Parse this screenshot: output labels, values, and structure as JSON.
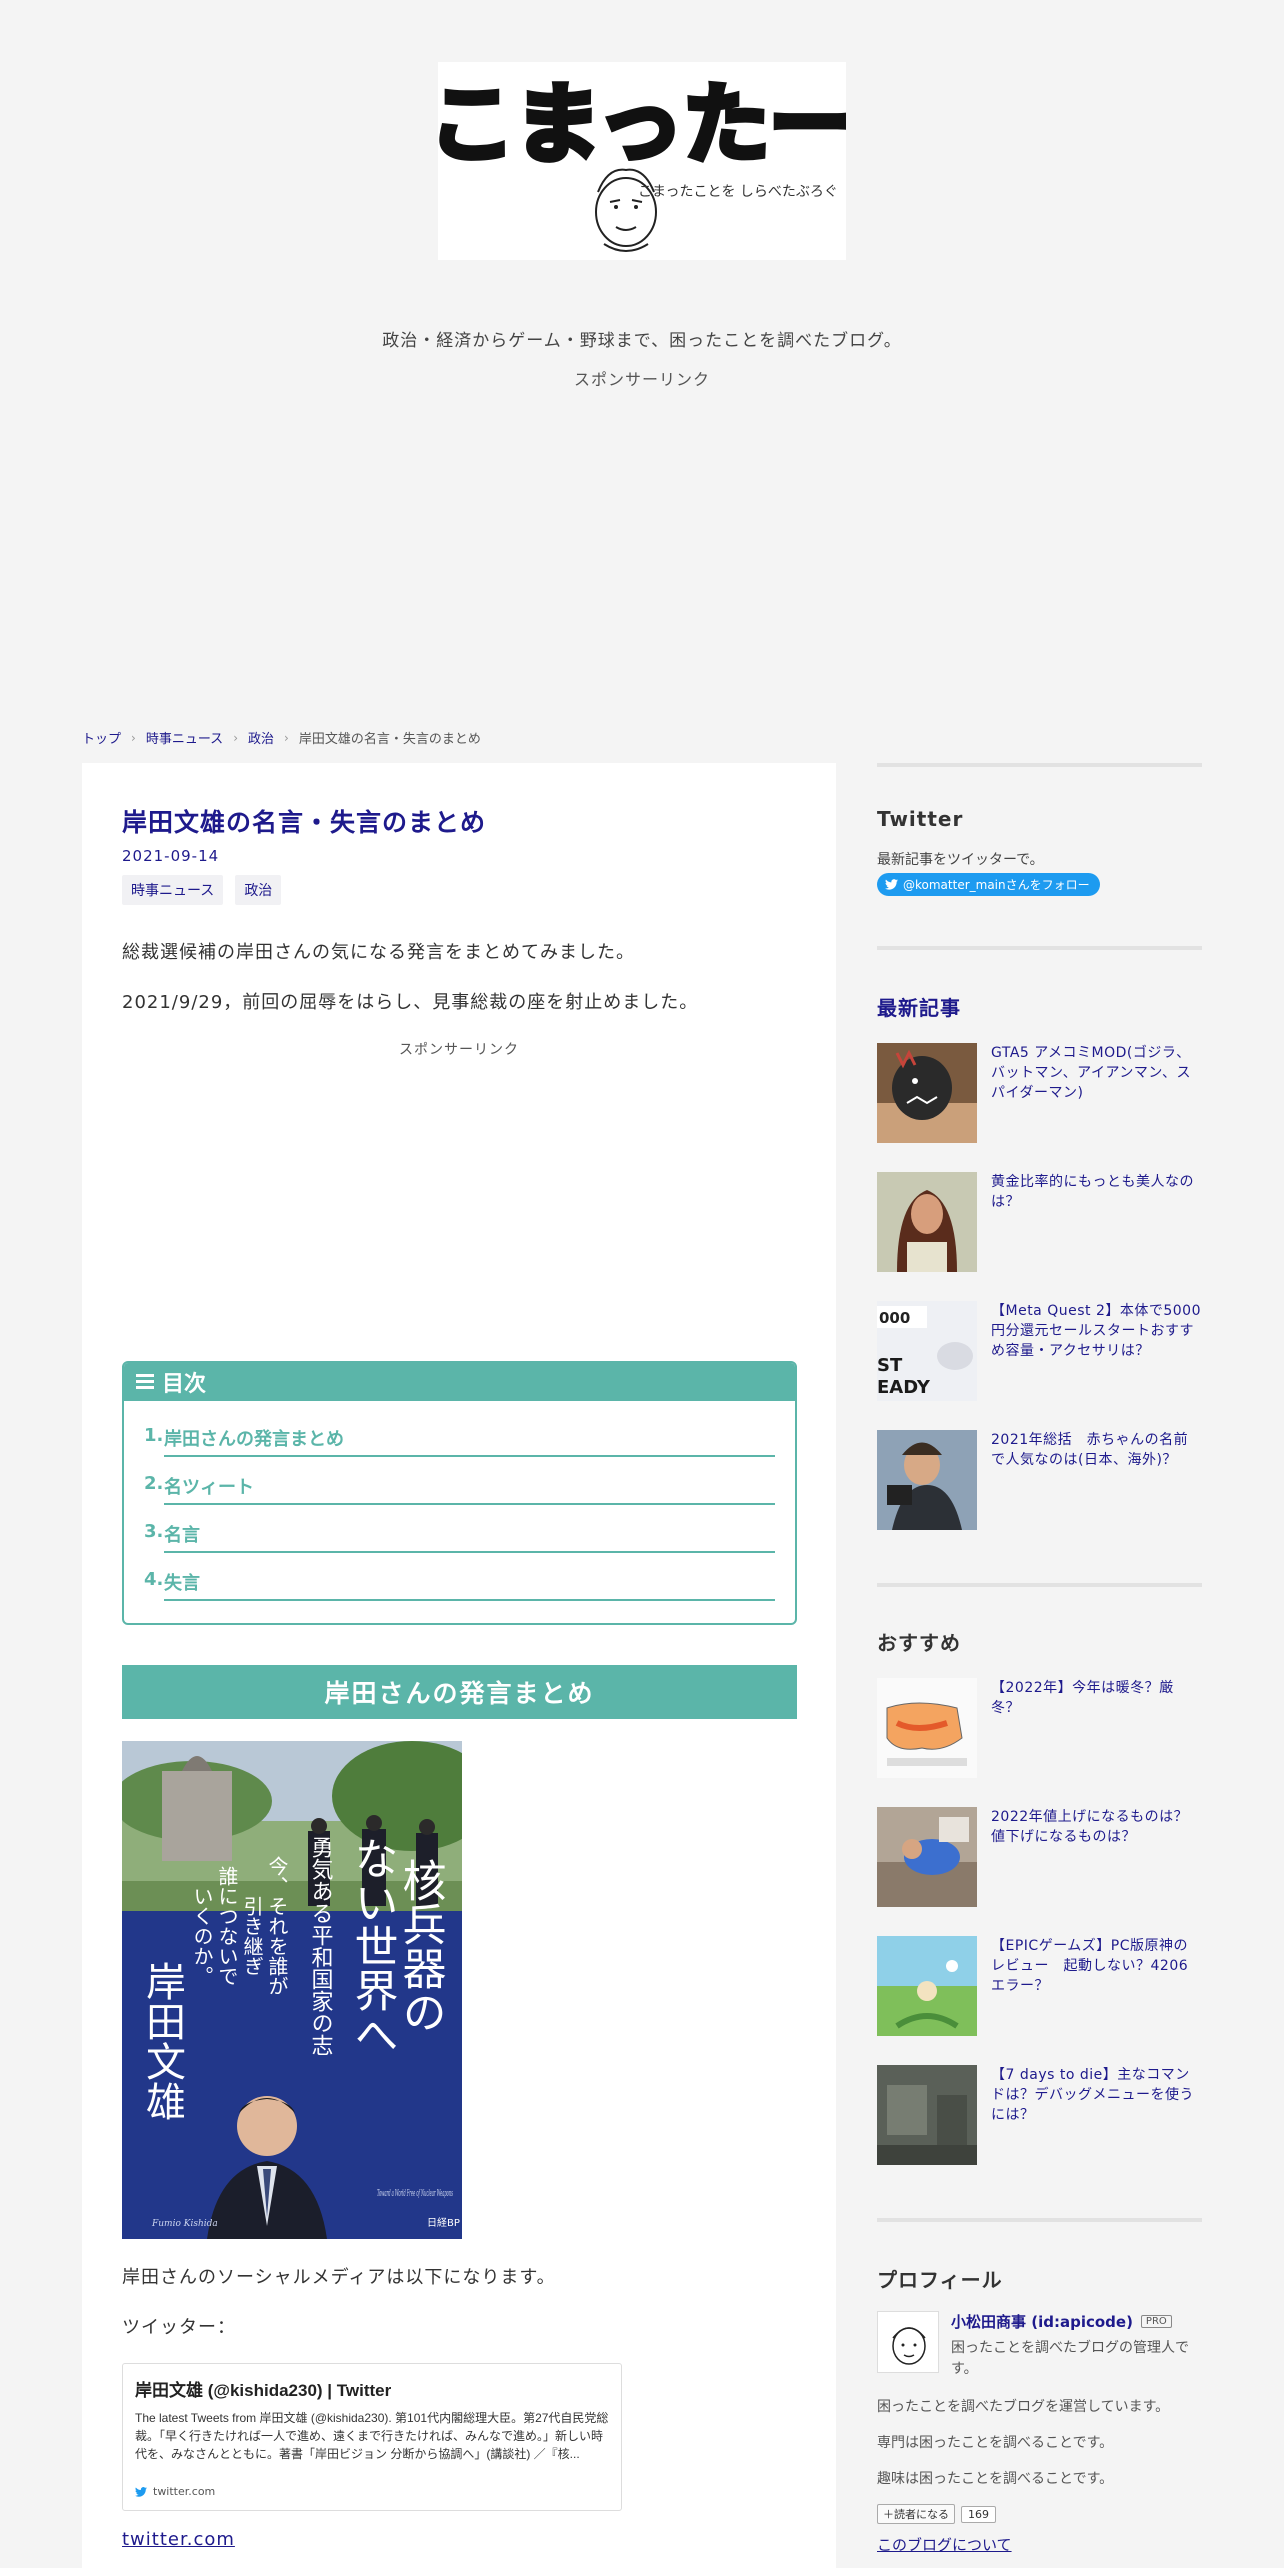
{
  "header": {
    "logo_text": "こまったー",
    "logo_sub": "こまったことを しらべたぶろぐ",
    "tagline": "政治・経済からゲーム・野球まで、困ったことを調べたブログ。",
    "sponsor": "スポンサーリンク"
  },
  "breadcrumb": {
    "items": [
      "トップ",
      "時事ニュース",
      "政治"
    ],
    "current": "岸田文雄の名言・失言のまとめ"
  },
  "article": {
    "title": "岸田文雄の名言・失言のまとめ",
    "date": "2021-09-14",
    "tags": [
      "時事ニュース",
      "政治"
    ],
    "lead1": "総裁選候補の岸田さんの気になる発言をまとめてみました。",
    "lead2": "2021/9/29，前回の屈辱をはらし、見事総裁の座を射止めました。",
    "sponsor": "スポンサーリンク",
    "toc": {
      "title": "目次",
      "items": [
        {
          "num": "1.",
          "label": "岸田さんの発言まとめ"
        },
        {
          "num": "2.",
          "label": "名ツィート"
        },
        {
          "num": "3.",
          "label": "名言"
        },
        {
          "num": "4.",
          "label": "失言"
        }
      ]
    },
    "section_heading": "岸田さんの発言まとめ",
    "book": {
      "title_lines": [
        "核兵器の",
        "ない世界へ"
      ],
      "subtitle": "勇気ある平和国家の志",
      "catch_lines": [
        "今、それを誰が",
        "引き継ぎ",
        "誰につないで",
        "いくのか。"
      ],
      "author": "岸田文雄",
      "publisher": "日経BP",
      "en_title": "Toward a World Free of Nuclear Weapons",
      "en_author": "Fumio Kishida"
    },
    "social_text": "岸田さんのソーシャルメディアは以下になります。",
    "twitter_label": "ツイッター：",
    "tweet_card": {
      "title": "岸田文雄 (@kishida230) | Twitter",
      "desc": "The latest Tweets from 岸田文雄 (@kishida230). 第101代内閣総理大臣。第27代自民党総裁。「早く行きたければ一人で進め、遠くまで行きたければ、みんなで進め。」新しい時代を、みなさんとともに。著書「岸田ビジョン 分断から協調へ」(講談社) ／『核...",
      "source": "twitter.com"
    },
    "link": "twitter.com"
  },
  "sidebar": {
    "twitter": {
      "title": "Twitter",
      "desc": "最新記事をツイッターで。",
      "follow": "@komatter_mainさんをフォロー"
    },
    "latest": {
      "title": "最新記事",
      "items": [
        {
          "title": "GTA5 アメコミMOD(ゴジラ、バットマン、アイアンマン、スパイダーマン)"
        },
        {
          "title": "黄金比率的にもっとも美人なのは？"
        },
        {
          "title": "【Meta Quest 2】本体で5000円分還元セールスタートおすすめ容量・アクセサリは？"
        },
        {
          "title": "2021年総括　赤ちゃんの名前で人気なのは(日本、海外)？"
        }
      ]
    },
    "recommend": {
      "title": "おすすめ",
      "items": [
        {
          "title": "【2022年】今年は暖冬？厳冬？"
        },
        {
          "title": "2022年値上げになるものは？値下げになるものは？"
        },
        {
          "title": "【EPICゲームズ】PC版原神のレビュー　起動しない？4206エラー？"
        },
        {
          "title": "【7 days to die】主なコマンドは？デバッグメニューを使うには？"
        }
      ]
    },
    "profile": {
      "title": "プロフィール",
      "name": "小松田商事 (id:apicode)",
      "badge": "PRO",
      "desc": "困ったことを調べたブログの管理人です。",
      "line1": "困ったことを調べたブログを運営しています。",
      "line2": "専門は困ったことを調べることです。",
      "line3": "趣味は困ったことを調べることです。",
      "reader_btn": "読者になる",
      "reader_count": "169",
      "about": "このブログについて"
    }
  },
  "colors": {
    "accent": "#1e1a8c",
    "teal": "#5bb5a9",
    "twitter_blue": "#1d9bf0",
    "background": "#f4f4f4"
  }
}
